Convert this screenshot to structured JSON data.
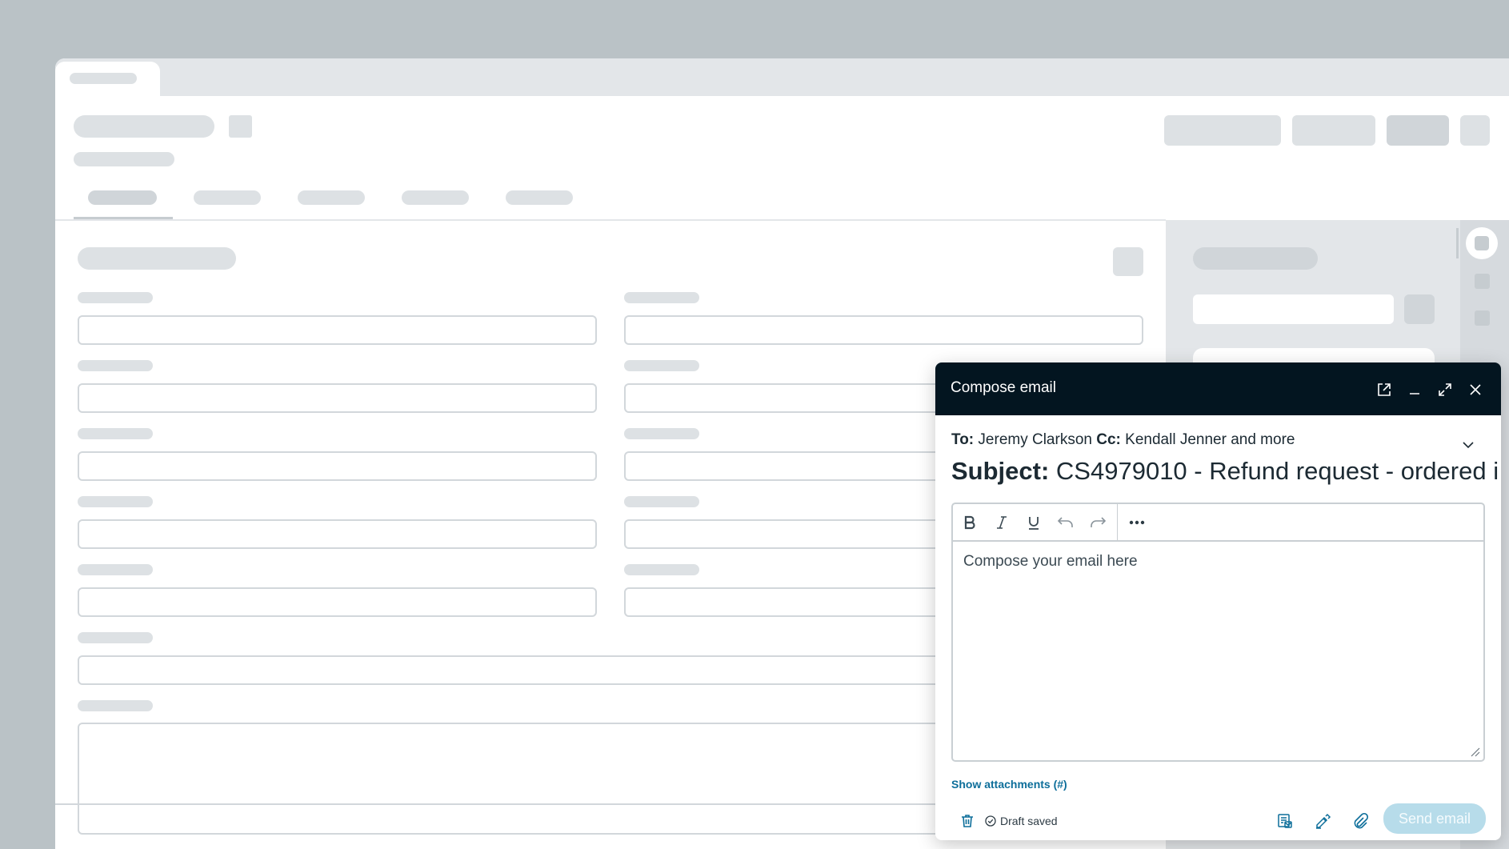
{
  "compose": {
    "title": "Compose email",
    "to_label": "To:",
    "to_value": "Jeremy Clarkson",
    "cc_label": "Cc:",
    "cc_value": "Kendall Jenner and more",
    "subject_label": "Subject:",
    "subject_value": "CS4979010 - Refund request - ordered i",
    "editor_placeholder": "Compose your email here",
    "show_attachments": "Show attachments (#)",
    "draft_status": "Draft saved",
    "send_label": "Send email"
  },
  "icons": {
    "header": [
      "open-in-new-window-icon",
      "minimize-icon",
      "expand-icon",
      "close-icon"
    ],
    "toolbar": [
      "bold-icon",
      "italic-icon",
      "underline-icon",
      "undo-icon",
      "redo-icon",
      "more-options-icon"
    ],
    "footer": [
      "delete-icon",
      "check-circle-icon",
      "templates-icon",
      "signature-icon",
      "attach-icon"
    ]
  },
  "colors": {
    "header_bg": "#031520",
    "link": "#0d6e9a",
    "send_disabled_bg": "#b7dcea",
    "backdrop": "#bac2c6"
  }
}
